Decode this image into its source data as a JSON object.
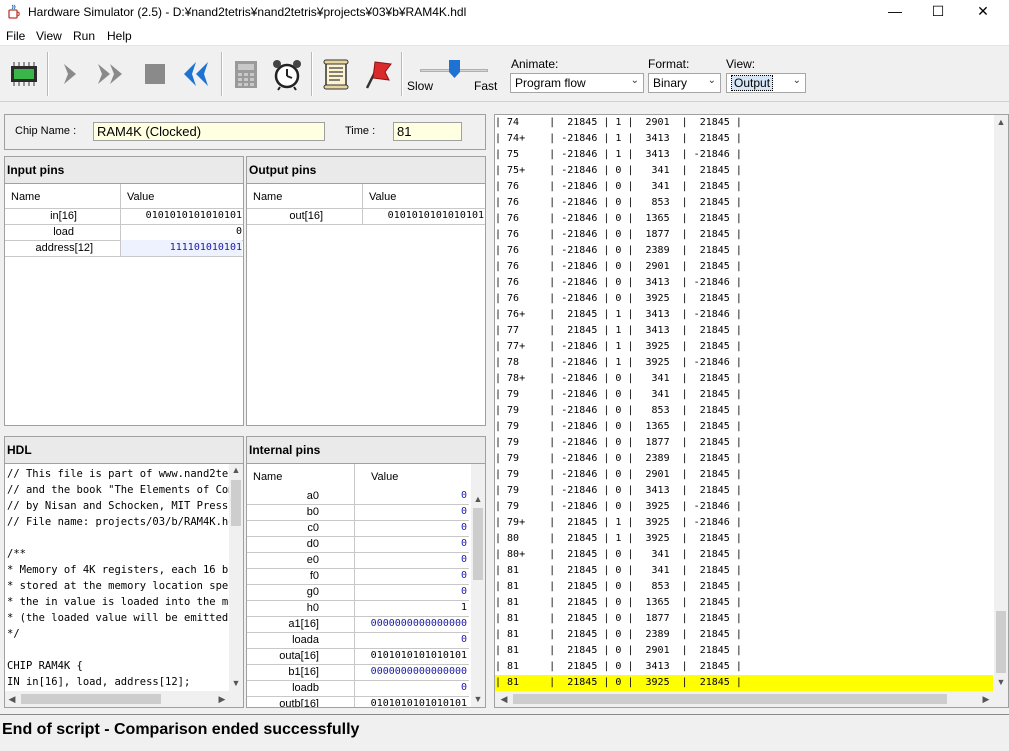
{
  "window": {
    "title": "Hardware Simulator (2.5) - D:¥nand2tetris¥nand2tetris¥projects¥03¥b¥RAM4K.hdl",
    "minimize": "—",
    "maximize": "☐",
    "close": "✕"
  },
  "menu": [
    "File",
    "View",
    "Run",
    "Help"
  ],
  "toolbar": {
    "slow_label": "Slow",
    "fast_label": "Fast",
    "speed_level": 0.5,
    "animate_label": "Animate:",
    "animate_value": "Program flow",
    "format_label": "Format:",
    "format_value": "Binary",
    "view_label": "View:",
    "view_value": "Output"
  },
  "chip": {
    "name_label": "Chip Name :",
    "name_value": "RAM4K (Clocked)",
    "time_label": "Time :",
    "time_value": "81"
  },
  "input_pins": {
    "title": "Input pins",
    "col_name": "Name",
    "col_value": "Value",
    "rows": [
      {
        "name": "in[16]",
        "value": "0101010101010101"
      },
      {
        "name": "load",
        "value": "0"
      },
      {
        "name": "address[12]",
        "value": "111101010101"
      }
    ]
  },
  "output_pins": {
    "title": "Output pins",
    "col_name": "Name",
    "col_value": "Value",
    "rows": [
      {
        "name": "out[16]",
        "value": "0101010101010101"
      }
    ]
  },
  "hdl": {
    "title": "HDL",
    "lines": [
      "// This file is part of www.nand2tetr",
      "// and the book \"The Elements of Comp",
      "// by Nisan and Schocken, MIT Press.",
      "// File name: projects/03/b/RAM4K.hdl",
      "",
      "/**",
      " * Memory of 4K registers, each 16 bi",
      " * stored at the memory location spec",
      " * the in value is loaded into the me",
      " * (the loaded value will be emitted",
      " */",
      "",
      "CHIP RAM4K {",
      "    IN in[16], load, address[12];"
    ]
  },
  "internal_pins": {
    "title": "Internal pins",
    "col_name": "Name",
    "col_value": "Value",
    "rows": [
      {
        "name": "a0",
        "value": "0"
      },
      {
        "name": "b0",
        "value": "0"
      },
      {
        "name": "c0",
        "value": "0"
      },
      {
        "name": "d0",
        "value": "0"
      },
      {
        "name": "e0",
        "value": "0"
      },
      {
        "name": "f0",
        "value": "0"
      },
      {
        "name": "g0",
        "value": "0"
      },
      {
        "name": "h0",
        "value": "1"
      },
      {
        "name": "a1[16]",
        "value": "0000000000000000"
      },
      {
        "name": "loada",
        "value": "0"
      },
      {
        "name": "outa[16]",
        "value": "0101010101010101"
      },
      {
        "name": "b1[16]",
        "value": "0000000000000000"
      },
      {
        "name": "loadb",
        "value": "0"
      },
      {
        "name": "outb[16]",
        "value": "0101010101010101"
      }
    ]
  },
  "output_table": {
    "rows": [
      "| 74     |  21845 | 1 |  2901  |  21845 |",
      "| 74+    | -21846 | 1 |  3413  |  21845 |",
      "| 75     | -21846 | 1 |  3413  | -21846 |",
      "| 75+    | -21846 | 0 |   341  |  21845 |",
      "| 76     | -21846 | 0 |   341  |  21845 |",
      "| 76     | -21846 | 0 |   853  |  21845 |",
      "| 76     | -21846 | 0 |  1365  |  21845 |",
      "| 76     | -21846 | 0 |  1877  |  21845 |",
      "| 76     | -21846 | 0 |  2389  |  21845 |",
      "| 76     | -21846 | 0 |  2901  |  21845 |",
      "| 76     | -21846 | 0 |  3413  | -21846 |",
      "| 76     | -21846 | 0 |  3925  |  21845 |",
      "| 76+    |  21845 | 1 |  3413  | -21846 |",
      "| 77     |  21845 | 1 |  3413  |  21845 |",
      "| 77+    | -21846 | 1 |  3925  |  21845 |",
      "| 78     | -21846 | 1 |  3925  | -21846 |",
      "| 78+    | -21846 | 0 |   341  |  21845 |",
      "| 79     | -21846 | 0 |   341  |  21845 |",
      "| 79     | -21846 | 0 |   853  |  21845 |",
      "| 79     | -21846 | 0 |  1365  |  21845 |",
      "| 79     | -21846 | 0 |  1877  |  21845 |",
      "| 79     | -21846 | 0 |  2389  |  21845 |",
      "| 79     | -21846 | 0 |  2901  |  21845 |",
      "| 79     | -21846 | 0 |  3413  |  21845 |",
      "| 79     | -21846 | 0 |  3925  | -21846 |",
      "| 79+    |  21845 | 1 |  3925  | -21846 |",
      "| 80     |  21845 | 1 |  3925  |  21845 |",
      "| 80+    |  21845 | 0 |   341  |  21845 |",
      "| 81     |  21845 | 0 |   341  |  21845 |",
      "| 81     |  21845 | 0 |   853  |  21845 |",
      "| 81     |  21845 | 0 |  1365  |  21845 |",
      "| 81     |  21845 | 0 |  1877  |  21845 |",
      "| 81     |  21845 | 0 |  2389  |  21845 |",
      "| 81     |  21845 | 0 |  2901  |  21845 |",
      "| 81     |  21845 | 0 |  3413  |  21845 |",
      "| 81     |  21845 | 0 |  3925  |  21845 |"
    ],
    "highlight_color": "#ffff00"
  },
  "status": "End of script - Comparison ended successfully",
  "colors": {
    "field_bg": "#ffffe1",
    "accent_blue": "#1e73d2",
    "binary_blue": "#1a1aa6"
  }
}
